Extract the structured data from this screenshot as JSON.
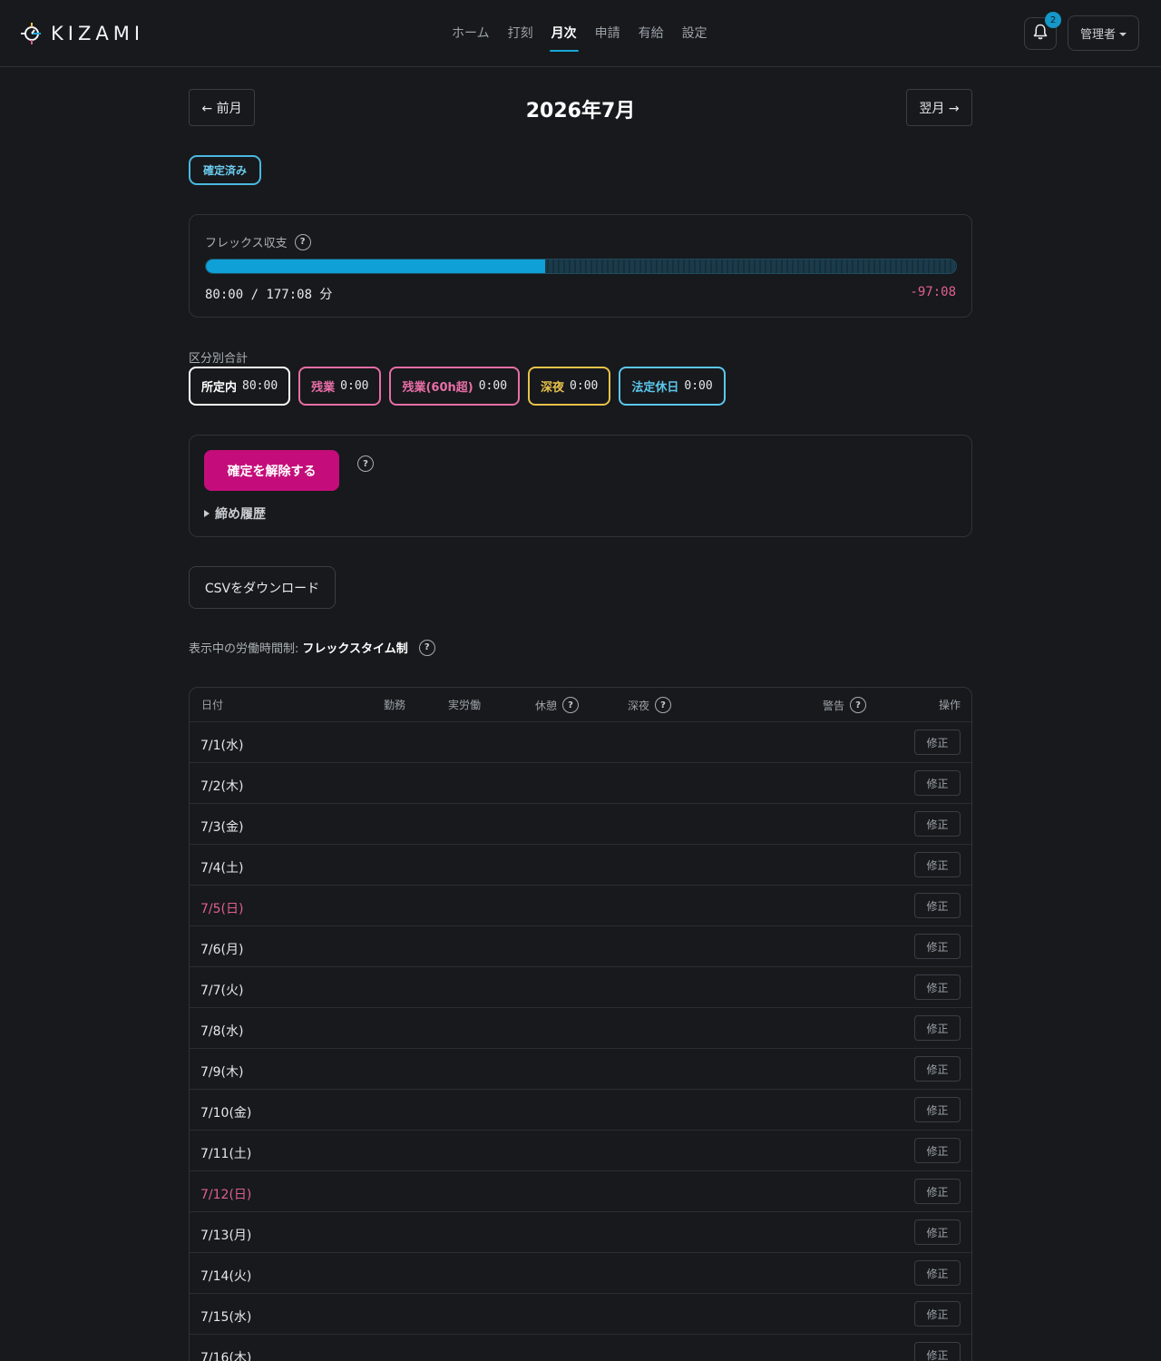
{
  "brand": {
    "name": "KIZAMI"
  },
  "nav": [
    {
      "label": "ホーム",
      "active": false
    },
    {
      "label": "打刻",
      "active": false
    },
    {
      "label": "月次",
      "active": true
    },
    {
      "label": "申請",
      "active": false
    },
    {
      "label": "有給",
      "active": false
    },
    {
      "label": "設定",
      "active": false
    }
  ],
  "notifications": {
    "count": "2",
    "icon": "bell-icon"
  },
  "user_menu": {
    "label": "管理者"
  },
  "month": {
    "prev_label": "← 前月",
    "title": "2026年7月",
    "next_label": "翌月 →"
  },
  "status_badge": "確定済み",
  "flex": {
    "label": "フレックス収支",
    "value_text": "80:00 / 177:08 分",
    "diff_text": "-97:08",
    "progress_fraction": 0.452
  },
  "totals": {
    "label": "区分別合計",
    "chips": [
      {
        "label": "所定内",
        "value": "80:00",
        "color": "#ffffff"
      },
      {
        "label": "残業",
        "value": "0:00",
        "color": "#e86ea6"
      },
      {
        "label": "残業(60h超)",
        "value": "0:00",
        "color": "#e86ea6"
      },
      {
        "label": "深夜",
        "value": "0:00",
        "color": "#e8c24a"
      },
      {
        "label": "法定休日",
        "value": "0:00",
        "color": "#5cc6ec"
      }
    ]
  },
  "confirm": {
    "unconfirm_label": "確定を解除する",
    "history_label": "締め履歴"
  },
  "csv_label": "CSVをダウンロード",
  "regime": {
    "prefix": "表示中の労働時間制:",
    "value": "フレックスタイム制"
  },
  "table": {
    "headers": {
      "date": "日付",
      "work": "勤務",
      "actual": "実労働",
      "break": "休憩",
      "night": "深夜",
      "warning": "警告",
      "action": "操作"
    },
    "fix_label": "修正",
    "rows": [
      {
        "date": "7/1(水)",
        "holiday": false
      },
      {
        "date": "7/2(木)",
        "holiday": false
      },
      {
        "date": "7/3(金)",
        "holiday": false
      },
      {
        "date": "7/4(土)",
        "holiday": false
      },
      {
        "date": "7/5(日)",
        "holiday": true
      },
      {
        "date": "7/6(月)",
        "holiday": false
      },
      {
        "date": "7/7(火)",
        "holiday": false
      },
      {
        "date": "7/8(水)",
        "holiday": false
      },
      {
        "date": "7/9(木)",
        "holiday": false
      },
      {
        "date": "7/10(金)",
        "holiday": false
      },
      {
        "date": "7/11(土)",
        "holiday": false
      },
      {
        "date": "7/12(日)",
        "holiday": true
      },
      {
        "date": "7/13(月)",
        "holiday": false
      },
      {
        "date": "7/14(火)",
        "holiday": false
      },
      {
        "date": "7/15(水)",
        "holiday": false
      },
      {
        "date": "7/16(木)",
        "holiday": false
      }
    ]
  }
}
